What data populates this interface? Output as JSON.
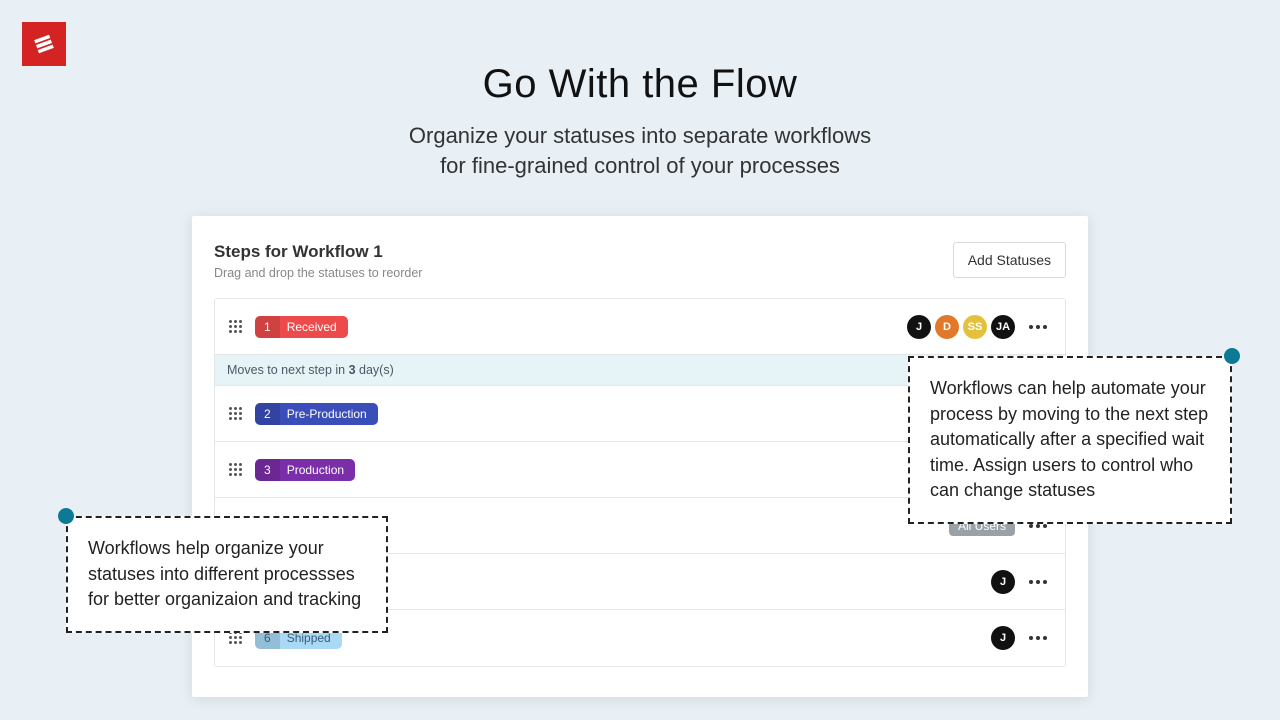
{
  "hero": {
    "title": "Go With the Flow",
    "subtitle_line1": "Organize your statuses into separate workflows",
    "subtitle_line2": "for fine-grained control of your processes"
  },
  "panel": {
    "title": "Steps for Workflow 1",
    "subtitle": "Drag and drop the statuses to reorder",
    "add_button": "Add Statuses"
  },
  "info_bar": {
    "prefix": "Moves to next step in ",
    "days": "3",
    "suffix": " day(s)"
  },
  "steps": [
    {
      "num": "1",
      "label": "Received",
      "color": "#ed4b4b"
    },
    {
      "num": "2",
      "label": "Pre-Production",
      "color": "#3a4db8"
    },
    {
      "num": "3",
      "label": "Production",
      "color": "#7a2ea8"
    },
    {
      "num": "6",
      "label": "Shipped",
      "color": "#7fc8ef",
      "dark_text": true
    }
  ],
  "row1_avatars": [
    {
      "text": "J",
      "bg": "#111"
    },
    {
      "text": "D",
      "bg": "#e07a2a"
    },
    {
      "text": "SS",
      "bg": "#e4c13c"
    },
    {
      "text": "JA",
      "bg": "#111"
    }
  ],
  "all_users_chip": "All Users",
  "single_avatar": {
    "text": "J",
    "bg": "#111"
  },
  "callout_left": "Workflows help organize your statuses into different processses for better organizaion and tracking",
  "callout_right": "Workflows can help automate your process by moving to the next step automatically after a specified wait time. Assign users to control who can change statuses"
}
